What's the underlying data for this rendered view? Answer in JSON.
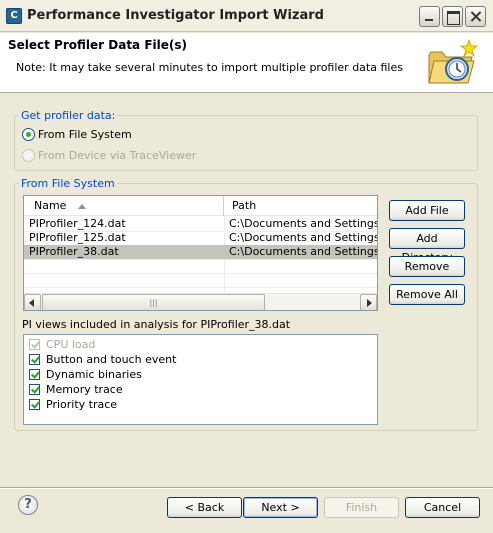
{
  "window": {
    "title": "Performance Investigator Import Wizard",
    "app_icon_letter": "C"
  },
  "header": {
    "title": "Select Profiler Data File(s)",
    "note": "Note: It may take several minutes to import multiple profiler data files",
    "icon": "folder-clock-icon"
  },
  "get_profiler_data": {
    "legend": "Get profiler data:",
    "options": [
      {
        "label": "From File System",
        "checked": true,
        "enabled": true
      },
      {
        "label": "From Device via TraceViewer",
        "checked": false,
        "enabled": false
      }
    ]
  },
  "from_file_system": {
    "legend": "From File System",
    "columns": [
      "Name",
      "Path"
    ],
    "rows": [
      {
        "name": "PIProfiler_124.dat",
        "path": "C:\\Documents and Settings\\De"
      },
      {
        "name": "PIProfiler_125.dat",
        "path": "C:\\Documents and Settings\\De"
      },
      {
        "name": "PIProfiler_38.dat",
        "path": "C:\\Documents and Settings\\De",
        "selected": true
      }
    ],
    "buttons": {
      "add_file": "Add File",
      "add_directory": "Add Directory",
      "remove": "Remove",
      "remove_all": "Remove All"
    },
    "pi_views_label": "PI views included in analysis for PIProfiler_38.dat",
    "views": [
      {
        "label": "CPU load",
        "checked": true,
        "enabled": false
      },
      {
        "label": "Button and touch event",
        "checked": true,
        "enabled": true
      },
      {
        "label": "Dynamic binaries",
        "checked": true,
        "enabled": true
      },
      {
        "label": "Memory trace",
        "checked": true,
        "enabled": true
      },
      {
        "label": "Priority trace",
        "checked": true,
        "enabled": true
      }
    ]
  },
  "footer": {
    "help": "?",
    "back": "< Back",
    "next": "Next >",
    "finish": "Finish",
    "cancel": "Cancel"
  },
  "colors": {
    "legend_blue": "#0046d5",
    "dialog_bg": "#ece9d8",
    "selection": "#c4c3bc"
  }
}
